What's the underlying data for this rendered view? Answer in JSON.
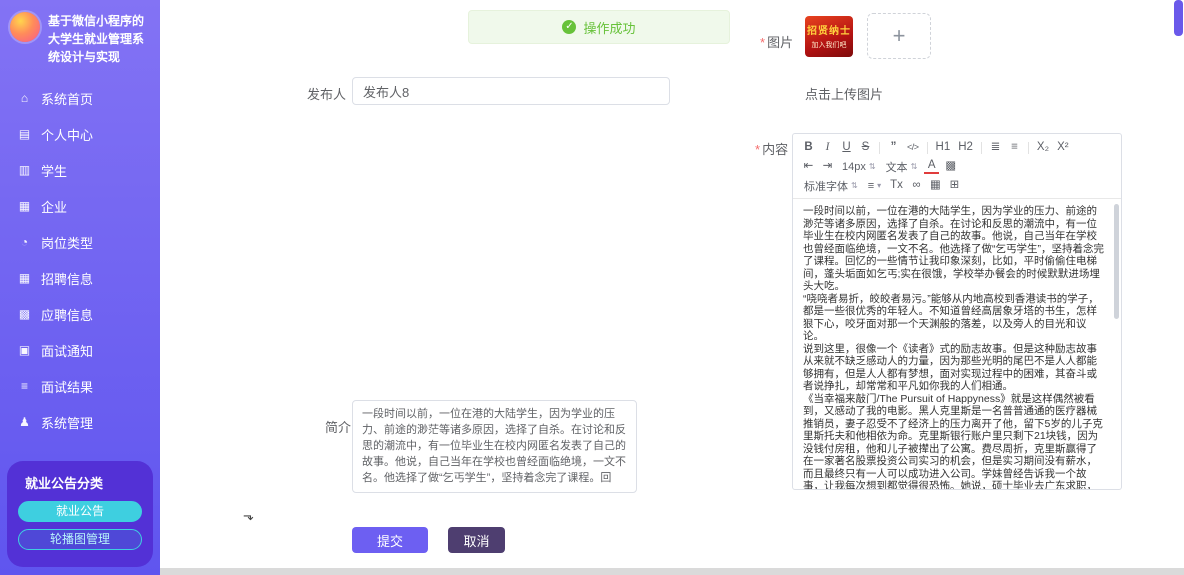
{
  "colors": {
    "sidebar_gradient_top": "#8373f4",
    "sidebar_gradient_bottom": "#5f55ef",
    "panel_purple": "#5331d6",
    "cyan_accent": "#3ecfe0",
    "success_green": "#67c23a",
    "required_red": "#f56c6c",
    "submit_purple": "#6d5ff2",
    "cancel_dark_purple": "#4e3e70"
  },
  "sidebar": {
    "logo_title": "基于微信小程序的大学生就业管理系统设计与实现",
    "items": [
      {
        "label": "系统首页",
        "icon": "⌂"
      },
      {
        "label": "个人中心",
        "icon": "▤"
      },
      {
        "label": "学生",
        "icon": "▥"
      },
      {
        "label": "企业",
        "icon": "▦"
      },
      {
        "label": "岗位类型",
        "icon": "◔"
      },
      {
        "label": "招聘信息",
        "icon": "▦"
      },
      {
        "label": "应聘信息",
        "icon": "▩"
      },
      {
        "label": "面试通知",
        "icon": "▣"
      },
      {
        "label": "面试结果",
        "icon": "≡"
      },
      {
        "label": "系统管理",
        "icon": "♟"
      }
    ],
    "panel": {
      "title": "就业公告分类",
      "buttons": [
        "就业公告",
        "轮播图管理"
      ]
    }
  },
  "toast": {
    "check": "✓",
    "text": "操作成功"
  },
  "form": {
    "publisher": {
      "label": "发布人",
      "value": "发布人8"
    },
    "image": {
      "required_mark": "*",
      "label": "图片",
      "plus": "+",
      "hint": "点击上传图片",
      "poster_line1": "招贤纳士",
      "poster_line2": "加入我们吧"
    },
    "content": {
      "required_mark": "*",
      "label": "内容"
    },
    "intro": {
      "label": "简介",
      "value": "一段时间以前，一位在港的大陆学生，因为学业的压力、前途的渺茫等诸多原因，选择了自杀。在讨论和反思的潮流中，有一位毕业生在校内网匿名发表了自己的故事。他说，自己当年在学校也曾经面临绝境，一文不名。他选择了做“乞丐学生”，坚持着念完了课程。回"
    },
    "actions": {
      "submit": "提交",
      "cancel": "取消"
    }
  },
  "editor": {
    "toolbar": {
      "bold": "B",
      "italic": "I",
      "underline": "U",
      "strike": "S",
      "quote": "”",
      "code": "</>",
      "h1": "H1",
      "h2": "H2",
      "ordered_list": "≣",
      "unordered_list": "≡",
      "subscript": "X₂",
      "superscript": "X²",
      "outdent": "⇤",
      "indent": "⇥",
      "font_size": "14px",
      "format": "文本",
      "color": "A",
      "highlight": "▩",
      "font_family": "标准字体",
      "align": "≡",
      "clear_format": "Tx",
      "link": "∞",
      "image": "▦",
      "fullscreen": "⊞",
      "caret": "⇅",
      "caret_down": "▾"
    },
    "text": "一段时间以前，一位在港的大陆学生，因为学业的压力、前途的渺茫等诸多原因，选择了自杀。在讨论和反思的潮流中，有一位毕业生在校内网匿名发表了自己的故事。他说，自己当年在学校也曾经面临绝境，一文不名。他选择了做“乞丐学生”，坚持着念完了课程。回忆的一些情节让我印象深刻，比如，平时偷偷住电梯间，蓬头垢面如乞丐;实在很饿，学校举办餐会的时候默默进场埋头大吃。\n“哓哓者易折，皎皎者易污。”能够从内地高校到香港读书的学子，都是一些很优秀的年轻人。不知道曾经高居象牙塔的书生，怎样狠下心，咬牙面对那一个天渊般的落差，以及旁人的目光和议论。\n说到这里，很像一个《读者》式的励志故事。但是这种励志故事从来就不缺乏感动人的力量，因为那些光明的尾巴不是人人都能够拥有，但是人人都有梦想，面对实现过程中的困难，其奋斗或者说挣扎，却常常和平凡如你我的人们相通。\n《当幸福来敲门/The Pursuit of Happyness》就是这样偶然被看到，又感动了我的电影。黑人克里斯是一名普普通通的医疗器械推销员，妻子忍受不了经济上的压力离开了他，留下5岁的儿子克里斯托夫和他相依为命。克里斯银行账户里只剩下21块钱，因为没钱付房租，他和儿子被撵出了公寓。费尽周折，克里斯赢得了在一家著名股票投资公司实习的机会，但是实习期间没有薪水，而且最终只有一人可以成功进入公司。学妹曾经告诉我一个故事，让我每次想到都觉得很恐怖。她说，硕士毕业去广东求职，一个中学要招几个老师，结果南来北往的硕士博士"
  }
}
